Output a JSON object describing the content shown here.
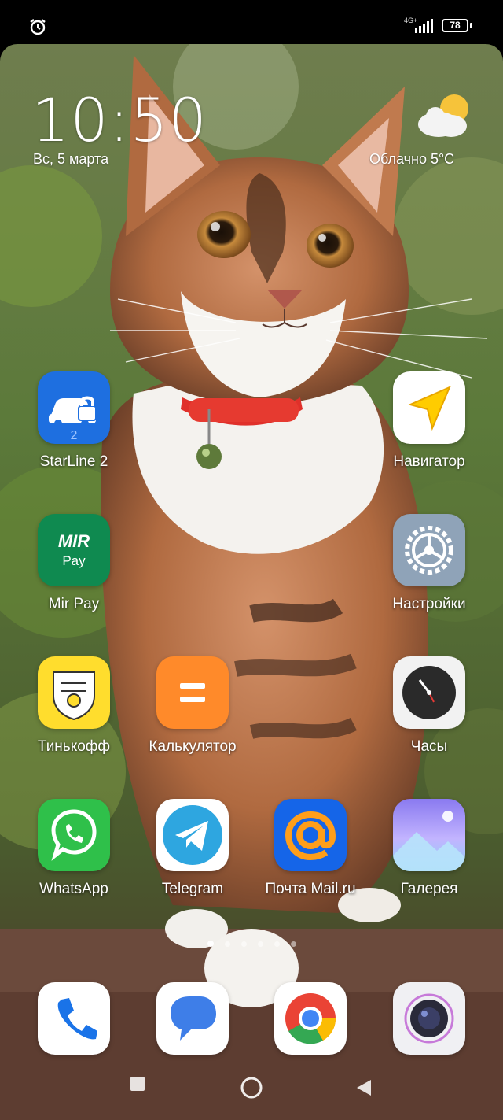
{
  "status_bar": {
    "network": "4G+",
    "battery": "78",
    "icons": [
      "alarm-icon",
      "signal-icon",
      "battery-icon"
    ]
  },
  "clock": {
    "time": "10:50",
    "date": "Вс, 5 марта"
  },
  "weather": {
    "condition": "Облачно",
    "temperature": "5°C",
    "icon": "partly-cloudy-icon"
  },
  "apps": {
    "starline": "StarLine 2",
    "navigator": "Навигатор",
    "mirpay": "Mir Pay",
    "settings": "Настройки",
    "tinkoff": "Тинькофф",
    "calculator": "Калькулятор",
    "clock": "Часы",
    "whatsapp": "WhatsApp",
    "telegram": "Telegram",
    "mail": "Почта Mail.ru",
    "gallery": "Галерея"
  },
  "icon_text": {
    "mir": "MIR",
    "pay": "Pay",
    "starline_digit": "2"
  },
  "dock": [
    "phone-icon",
    "messages-icon",
    "chrome-icon",
    "camera-icon"
  ],
  "page_indicator": {
    "pages": 6,
    "active": 1
  },
  "colors": {
    "starline": "#1e6fe0",
    "mirpay": "#0f8a50",
    "tinkoff": "#ffdd2d",
    "calculator": "#ff8a2a",
    "whatsapp": "#2fc04a",
    "telegram": "#2ea6e0",
    "mail": "#1565e8"
  }
}
